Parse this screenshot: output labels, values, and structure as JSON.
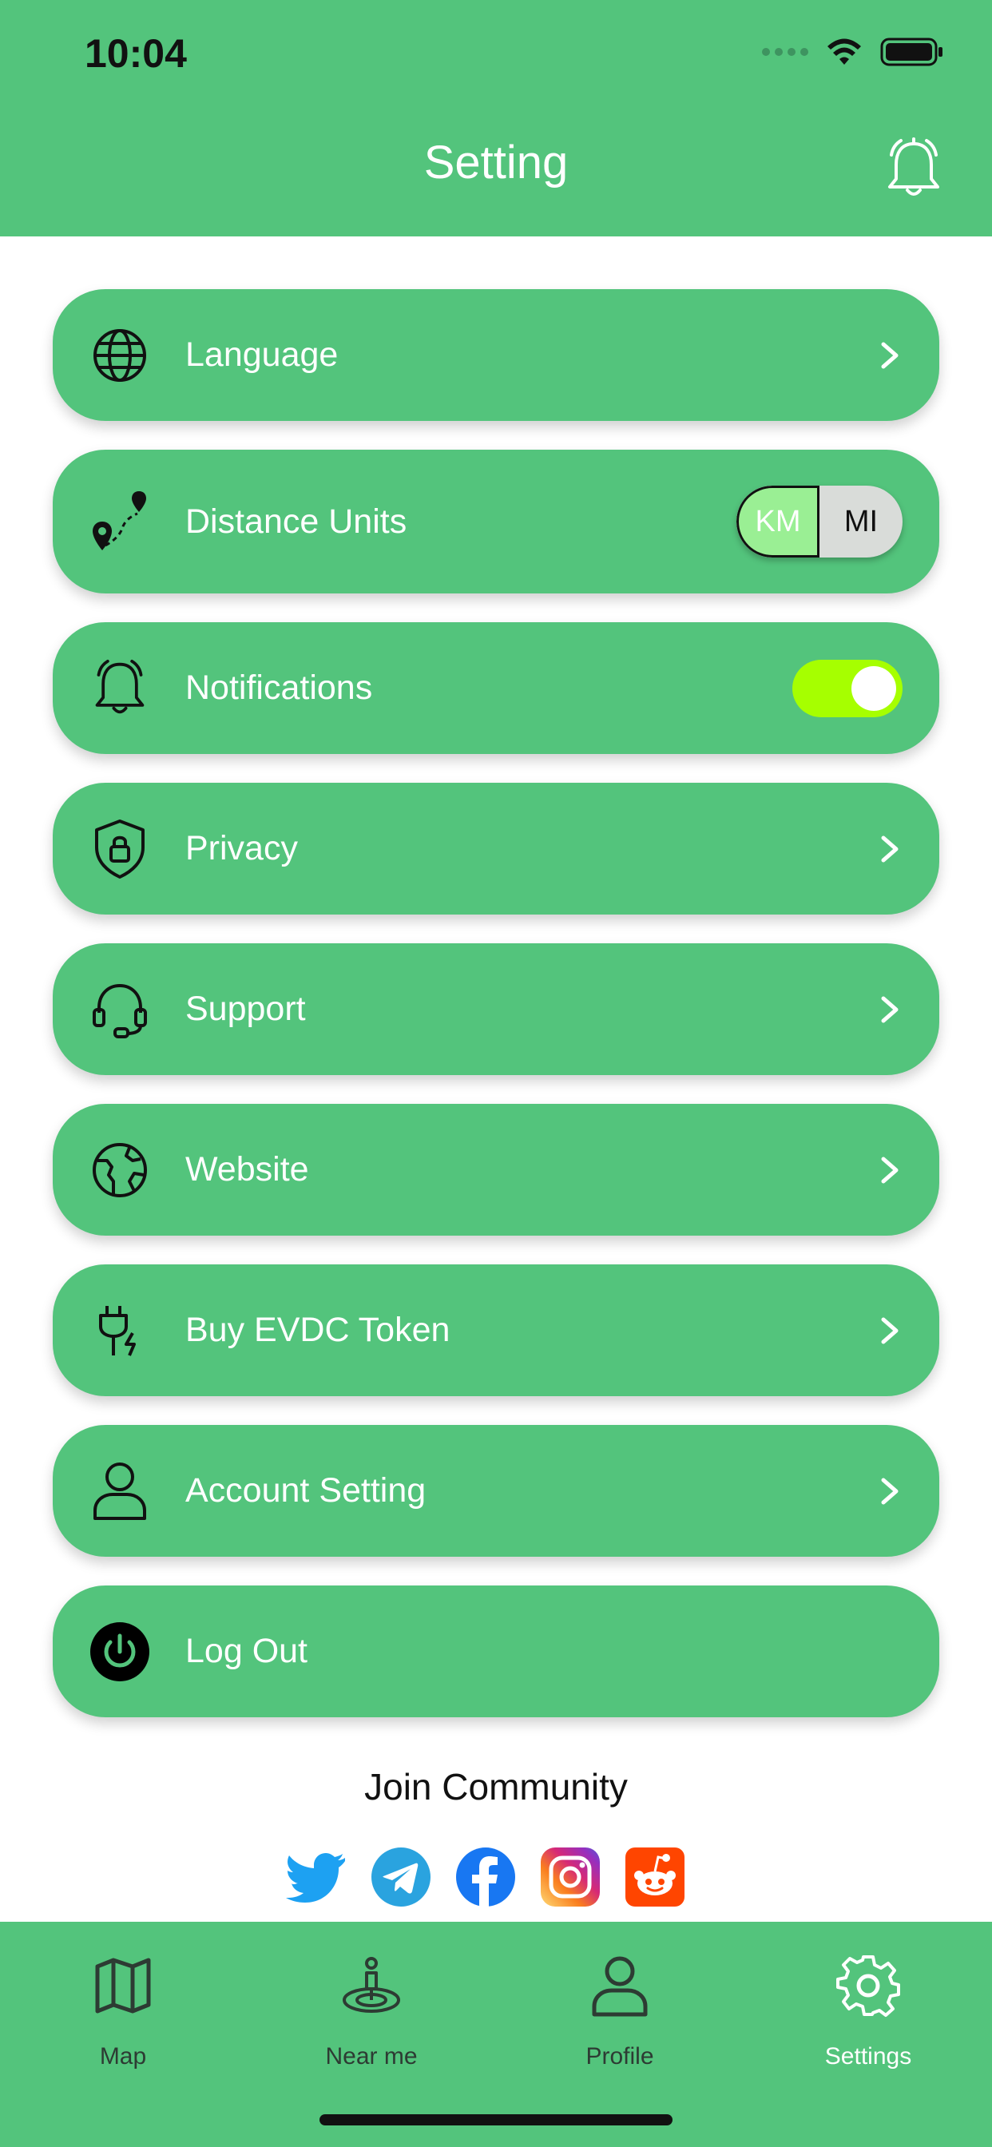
{
  "status_bar": {
    "time": "10:04"
  },
  "header": {
    "title": "Setting",
    "bell_icon": "bell-icon"
  },
  "settings": {
    "items": [
      {
        "label": "Language",
        "icon": "globe-icon"
      },
      {
        "label": "Distance Units",
        "icon": "route-pin-icon",
        "units": {
          "km": "KM",
          "mi": "MI",
          "selected": "KM"
        }
      },
      {
        "label": "Notifications",
        "icon": "bell-icon",
        "toggle_on": true
      },
      {
        "label": "Privacy",
        "icon": "shield-lock-icon"
      },
      {
        "label": "Support",
        "icon": "headset-icon"
      },
      {
        "label": "Website",
        "icon": "earth-icon"
      },
      {
        "label": "Buy EVDC Token",
        "icon": "plug-bolt-icon"
      },
      {
        "label": "Account Setting",
        "icon": "user-icon"
      },
      {
        "label": "Log Out",
        "icon": "power-icon"
      }
    ]
  },
  "community": {
    "title": "Join Community",
    "icons": [
      "twitter-icon",
      "telegram-icon",
      "facebook-icon",
      "instagram-icon",
      "reddit-icon"
    ]
  },
  "tabbar": {
    "tabs": [
      {
        "label": "Map",
        "icon": "map-icon"
      },
      {
        "label": "Near me",
        "icon": "location-person-icon"
      },
      {
        "label": "Profile",
        "icon": "person-icon"
      },
      {
        "label": "Settings",
        "icon": "gear-icon",
        "active": true
      }
    ]
  },
  "colors": {
    "primary_green": "#53c47c",
    "switch_on": "#a6ff00",
    "km_selected": "#9aef94"
  }
}
